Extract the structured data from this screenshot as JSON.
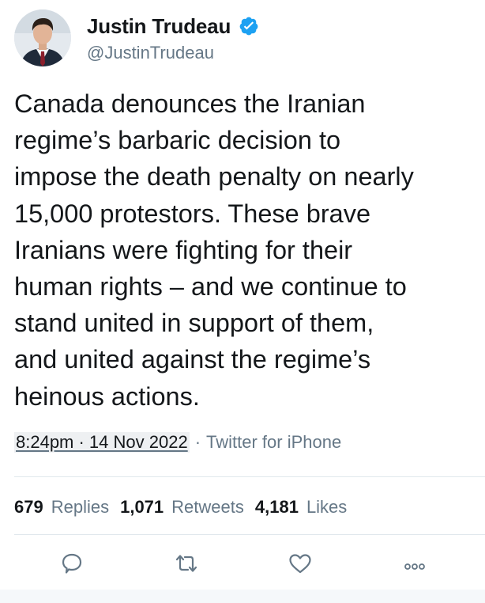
{
  "author": {
    "display_name": "Justin Trudeau",
    "handle": "@JustinTrudeau",
    "verified": true,
    "avatar_icon": "profile-photo"
  },
  "tweet": {
    "text": "Canada denounces the Iranian\nregime’s barbaric decision to\nimpose the death penalty on nearly\n15,000 protestors. These brave\nIranians were fighting for their\nhuman rights – and we continue to\nstand united in support of them,\nand united against the regime’s\nheinous actions.",
    "timestamp": "8:24pm · 14 Nov 2022",
    "separator": "·",
    "source": "Twitter for iPhone"
  },
  "stats": {
    "replies_count": "679",
    "replies_label": "Replies",
    "retweets_count": "1,071",
    "retweets_label": "Retweets",
    "likes_count": "4,181",
    "likes_label": "Likes"
  },
  "actions": [
    {
      "name": "reply",
      "icon": "speech-bubble-icon"
    },
    {
      "name": "retweet",
      "icon": "retweet-arrows-icon"
    },
    {
      "name": "like",
      "icon": "heart-icon"
    },
    {
      "name": "more",
      "icon": "more-dots-icon"
    }
  ],
  "colors": {
    "text": "#14171a",
    "secondary": "#657786",
    "verified_badge": "#1da1f2",
    "divider": "#e1e8ed"
  }
}
